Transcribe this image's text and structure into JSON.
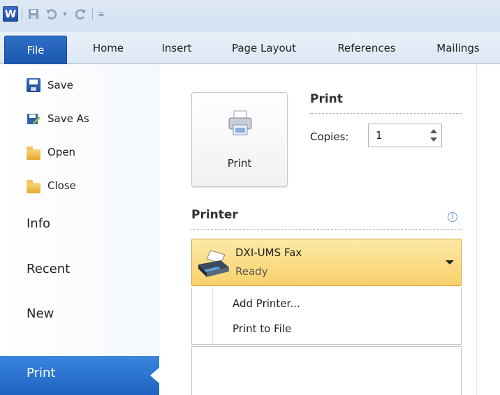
{
  "quick_access": {
    "app_icon_letter": "W",
    "icons": [
      "word-icon",
      "save-icon",
      "undo-icon",
      "dropdown-icon",
      "redo-icon",
      "customize-icon"
    ]
  },
  "tabs": [
    {
      "label": "File",
      "active": true
    },
    {
      "label": "Home"
    },
    {
      "label": "Insert"
    },
    {
      "label": "Page Layout"
    },
    {
      "label": "References"
    },
    {
      "label": "Mailings"
    }
  ],
  "nav": {
    "commands": [
      {
        "label": "Save",
        "icon": "save-icon"
      },
      {
        "label": "Save As",
        "icon": "save-as-icon"
      },
      {
        "label": "Open",
        "icon": "open-folder-icon"
      },
      {
        "label": "Close",
        "icon": "close-folder-icon"
      }
    ],
    "sections": [
      "Info",
      "Recent",
      "New",
      "Print"
    ],
    "active": "Print"
  },
  "print": {
    "section_title": "Print",
    "button_label": "Print",
    "copies_label": "Copies:",
    "copies_value": "1"
  },
  "printer": {
    "section_title": "Printer",
    "info_icon": "i",
    "selected_name": "DXI-UMS Fax",
    "selected_status": "Ready",
    "menu_items": [
      "Add Printer...",
      "Print to File"
    ]
  },
  "colors": {
    "file_tab": "#1a57ad",
    "nav_active": "#1e63c1",
    "printer_highlight": "#f8d16b"
  }
}
